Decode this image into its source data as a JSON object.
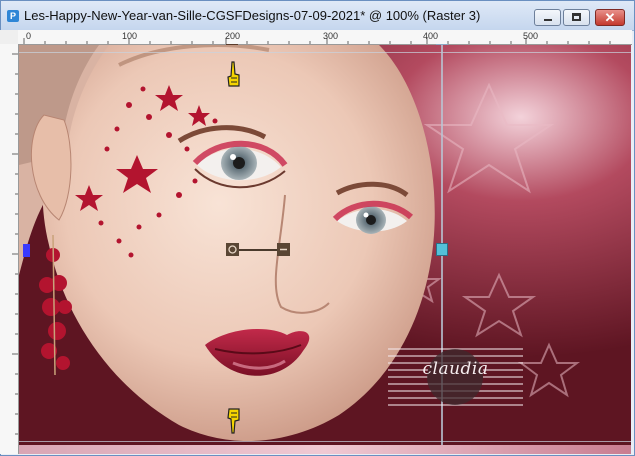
{
  "window": {
    "title": "Les-Happy-New-Year-van-Sille-CGSFDesigns-07-09-2021* @ 100% (Raster 3)",
    "app_icon_glyph": "P",
    "buttons": {
      "minimize": "minimize",
      "maximize": "maximize",
      "close": "✕"
    }
  },
  "ruler": {
    "ticks": [
      "0",
      "100",
      "200",
      "300",
      "400",
      "500"
    ]
  },
  "watermark": {
    "text": "claudia"
  },
  "colors": {
    "canvas_bg": "#8a2c3a",
    "guide": "#b9c6d4",
    "node_left": "#3a3aff",
    "node_right": "#54c1d8"
  },
  "icons": [
    "app-icon",
    "minimize-icon",
    "maximize-icon",
    "close-icon",
    "hand-pointer-icon",
    "rotation-handle-icon"
  ]
}
